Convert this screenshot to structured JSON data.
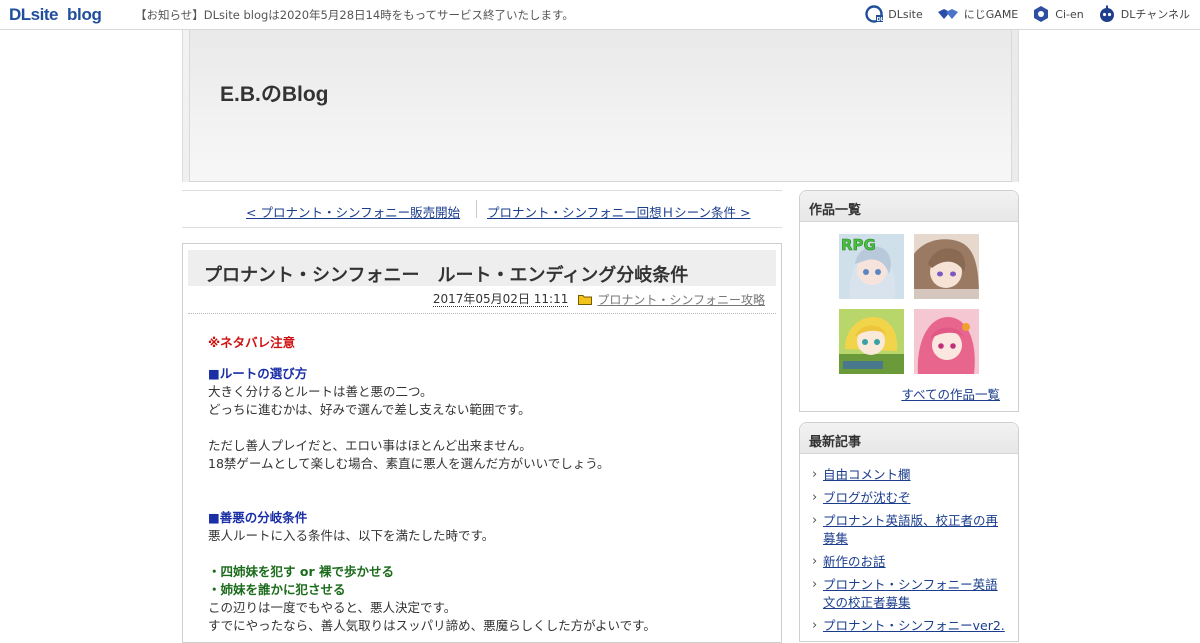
{
  "topbar": {
    "logo_dl": "DLsite",
    "logo_blog": "blog",
    "notice": "【お知らせ】DLsite blogは2020年5月28日14時をもってサービス終了いたします。",
    "links": [
      {
        "label": "DLsite",
        "icon": "dlsite-icon"
      },
      {
        "label": "にじGAME",
        "icon": "nijigame-icon"
      },
      {
        "label": "Ci-en",
        "icon": "cien-icon"
      },
      {
        "label": "DLチャンネル",
        "icon": "dlchannel-icon"
      }
    ]
  },
  "header": {
    "title": "E.B.のBlog"
  },
  "postnav": {
    "prev": "< プロナント・シンフォニー販売開始",
    "next": "プロナント・シンフォニー回想Ｈシーン条件 >"
  },
  "article": {
    "title": "プロナント・シンフォニー　ルート・エンディング分岐条件",
    "date": "2017年05月02日 11:11",
    "category": "プロナント・シンフォニー攻略",
    "warning": "※ネタバレ注意",
    "section1_heading": "■ルートの選び方",
    "p1_l1": "大きく分けるとルートは善と悪の二つ。",
    "p1_l2": "どっちに進むかは、好みで選んで差し支えない範囲です。",
    "p2_l1": "ただし善人プレイだと、エロい事はほとんど出来ません。",
    "p2_l2": "18禁ゲームとして楽しむ場合、素直に悪人を選んだ方がいいでしょう。",
    "section2_heading": "■善悪の分岐条件",
    "p3_l1": "悪人ルートに入る条件は、以下を満たした時です。",
    "cond1": "・四姉妹を犯す or 裸で歩かせる",
    "cond2": "・姉妹を誰かに犯させる",
    "p4_l1": "この辺りは一度でもやると、悪人決定です。",
    "p4_l2": "すでにやったなら、善人気取りはスッパリ諦め、悪魔らしくした方がよいです。"
  },
  "sidebar": {
    "works_title": "作品一覧",
    "works_thumb_text": "RPG",
    "all_works": "すべての作品一覧",
    "recent_title": "最新記事",
    "recent_items": [
      "自由コメント欄",
      "ブログが沈むぞ",
      "プロナント英語版、校正者の再募集",
      "新作のお話",
      "プロナント・シンフォニー英語文の校正者募集",
      "プロナント・シンフォニーver2."
    ]
  },
  "colors": {
    "link": "#1a3d8c",
    "warning": "#d01010",
    "heading": "#1a2fa6",
    "condition": "#1b6b1b",
    "logo": "#1f4f9c"
  }
}
